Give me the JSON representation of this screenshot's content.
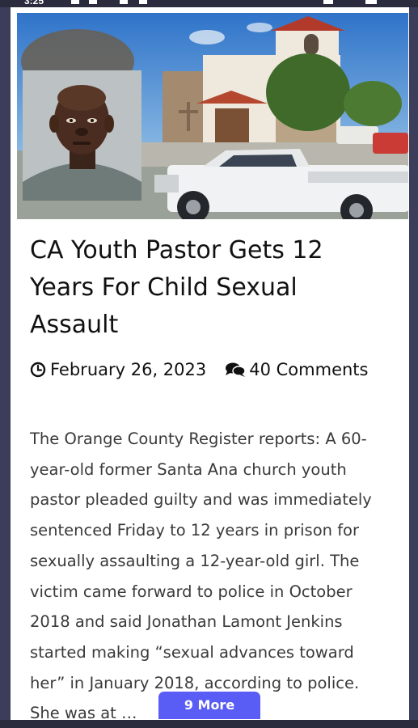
{
  "status_bar": {
    "time": "3:25"
  },
  "article": {
    "title": "CA Youth Pastor Gets 12 Years For Child Sexual Assault",
    "date": "February 26, 2023",
    "comments": "40 Comments",
    "excerpt": "The Orange County Register reports: A 60-year-old former Santa Ana church youth pastor pleaded guilty and was immediately sentenced Friday to 12 years in prison for sexually assaulting a 12-year-old girl. The victim came forward to police in October 2018 and said Jonathan Lamont Jenkins started making “sexual advances toward her” in January 2018, according to police. She was at …"
  },
  "more_button": {
    "label": "9 More"
  },
  "icons": {
    "date": "clock-icon",
    "comments": "comments-icon"
  },
  "colors": {
    "accent": "#5a5cf6",
    "page_background": "#3c3d5a",
    "card_background": "#ffffff",
    "title_text": "#111111",
    "body_text": "#3a3a3a"
  }
}
